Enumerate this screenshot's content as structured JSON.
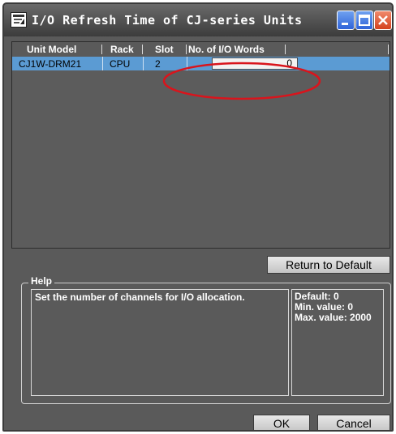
{
  "window": {
    "title": "I/O Refresh Time of CJ-series Units"
  },
  "title_buttons": {
    "minimize_icon": "minimize-icon",
    "maximize_icon": "maximize-icon",
    "close_icon": "close-icon"
  },
  "grid": {
    "columns": [
      "Unit Model",
      "Rack",
      "Slot",
      "No. of I/O Words"
    ],
    "rows": [
      {
        "unit_model": "CJ1W-DRM21",
        "rack": "CPU",
        "slot": "2",
        "io_words": "0"
      }
    ]
  },
  "buttons": {
    "return_default": "Return to Default",
    "ok": "OK",
    "cancel": "Cancel"
  },
  "help": {
    "legend": "Help",
    "text": "Set the number of channels for I/O allocation.",
    "default": "Default: 0",
    "min": "Min. value: 0",
    "max": "Max. value: 2000"
  },
  "colors": {
    "selected_row": "#5b9bd3",
    "annotation": "#d9141c",
    "window_bg": "#5a5a5a"
  }
}
